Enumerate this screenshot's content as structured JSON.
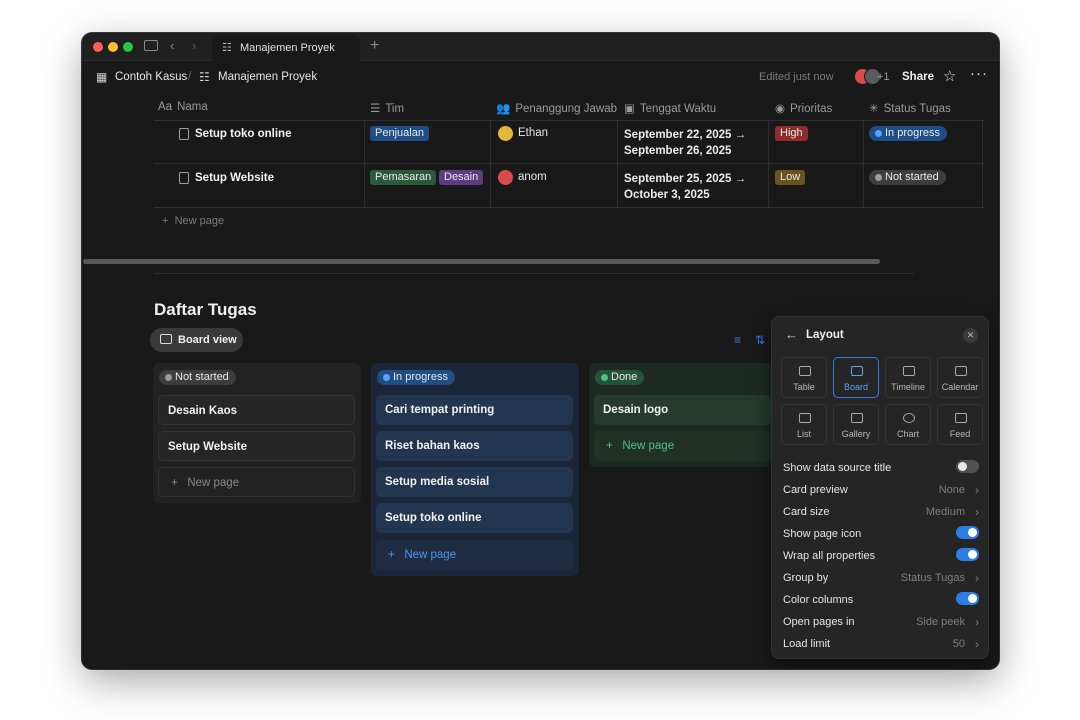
{
  "tab": {
    "title": "Manajemen Proyek"
  },
  "breadcrumb": {
    "workspace": "Contoh Kasus",
    "page": "Manajemen Proyek"
  },
  "header": {
    "edited": "Edited just now",
    "extra_users": "+1",
    "share": "Share"
  },
  "table": {
    "columns": [
      "Nama",
      "Tim",
      "Penanggung Jawab",
      "Tenggat Waktu",
      "Prioritas",
      "Status Tugas"
    ],
    "rows": [
      {
        "name": "Setup toko online",
        "tags": [
          "Penjualan"
        ],
        "person": "Ethan",
        "date1": "September 22, 2025 →",
        "date2": "September 26, 2025",
        "priority": "High",
        "status": "In progress"
      },
      {
        "name": "Setup Website",
        "tags": [
          "Pemasaran",
          "Desain"
        ],
        "person": "anom",
        "date1": "September 25, 2025 →",
        "date2": "October 3, 2025",
        "priority": "Low",
        "status": "Not started"
      }
    ],
    "new_page": "New page"
  },
  "board": {
    "title": "Daftar Tugas",
    "view_label": "Board view",
    "columns": [
      {
        "name": "Not started",
        "color": "#8a8a8a",
        "cards": [
          "Desain Kaos",
          "Setup Website"
        ],
        "new_page": "New page"
      },
      {
        "name": "In progress",
        "color": "#2f7ee6",
        "cards": [
          "Cari tempat printing",
          "Riset bahan kaos",
          "Setup media sosial",
          "Setup toko online"
        ],
        "new_page": "New page"
      },
      {
        "name": "Done",
        "color": "#35a66a",
        "cards": [
          "Desain logo"
        ],
        "new_page": "New page"
      }
    ]
  },
  "layout_panel": {
    "title": "Layout",
    "options": [
      "Table",
      "Board",
      "Timeline",
      "Calendar",
      "List",
      "Gallery",
      "Chart",
      "Feed"
    ],
    "selected": "Board",
    "settings": [
      {
        "label": "Show data source title",
        "type": "toggle",
        "on": false
      },
      {
        "label": "Card preview",
        "type": "value",
        "value": "None"
      },
      {
        "label": "Card size",
        "type": "value",
        "value": "Medium"
      },
      {
        "label": "Show page icon",
        "type": "toggle",
        "on": true
      },
      {
        "label": "Wrap all properties",
        "type": "toggle",
        "on": true
      },
      {
        "label": "Group by",
        "type": "value",
        "value": "Status Tugas"
      },
      {
        "label": "Color columns",
        "type": "toggle",
        "on": true
      },
      {
        "label": "Open pages in",
        "type": "value",
        "value": "Side peek"
      },
      {
        "label": "Load limit",
        "type": "value",
        "value": "50"
      }
    ]
  }
}
